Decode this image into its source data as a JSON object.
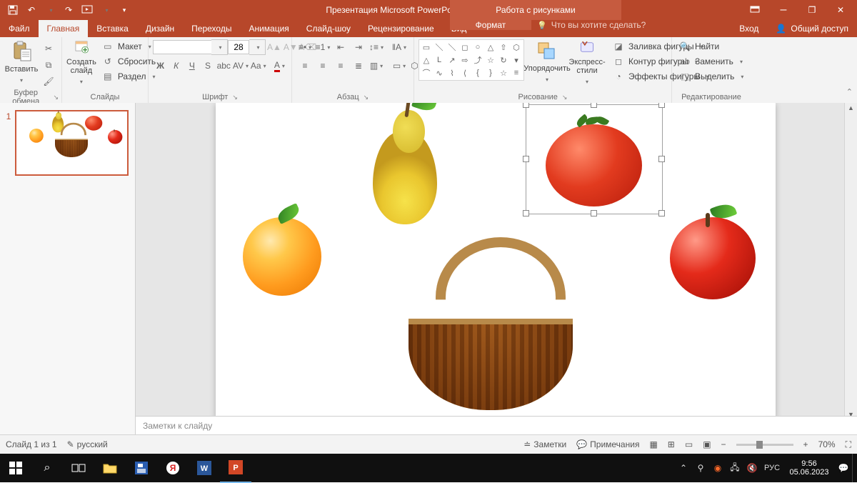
{
  "app": {
    "title": "Презентация Microsoft PowerPoint.pptx - PowerPoint",
    "context_tab_title": "Работа с рисунками"
  },
  "window_buttons": {
    "min": "–",
    "max": "❐",
    "close": "✕",
    "opts": "▭"
  },
  "qat": {
    "save": "💾",
    "undo": "↶",
    "redo": "↷",
    "start": "▶",
    "touch": "☝",
    "more": "▾"
  },
  "tabs": {
    "file": "Файл",
    "home": "Главная",
    "insert": "Вставка",
    "design": "Дизайн",
    "transitions": "Переходы",
    "animations": "Анимация",
    "slideshow": "Слайд-шоу",
    "review": "Рецензирование",
    "view": "Вид",
    "format": "Формат",
    "tell_me": "Что вы хотите сделать?",
    "signin": "Вход",
    "share": "Общий доступ"
  },
  "ribbon": {
    "clipboard": {
      "label": "Буфер обмена",
      "paste": "Вставить"
    },
    "slides": {
      "label": "Слайды",
      "new_slide": "Создать\nслайд",
      "layout": "Макет",
      "reset": "Сбросить",
      "section": "Раздел"
    },
    "font": {
      "label": "Шрифт",
      "name": "",
      "size": "28"
    },
    "paragraph": {
      "label": "Абзац"
    },
    "drawing": {
      "label": "Рисование",
      "arrange": "Упорядочить",
      "quick_styles": "Экспресс-\nстили",
      "fill": "Заливка фигуры",
      "outline": "Контур фигуры",
      "effects": "Эффекты фигуры"
    },
    "editing": {
      "label": "Редактирование",
      "find": "Найти",
      "replace": "Заменить",
      "select": "Выделить"
    }
  },
  "thumbs": {
    "n1": "1"
  },
  "slide_objects": {
    "pear": "pear",
    "tomato": "tomato",
    "orange": "orange",
    "apple": "apple",
    "basket": "basket",
    "selected": "tomato"
  },
  "notes_placeholder": "Заметки к слайду",
  "status": {
    "slide": "Слайд 1 из 1",
    "lang": "русский",
    "notes": "Заметки",
    "comments": "Примечания",
    "zoom": "70%"
  },
  "taskbar": {
    "lang": "РУС",
    "time": "9:56",
    "date": "05.06.2023"
  }
}
